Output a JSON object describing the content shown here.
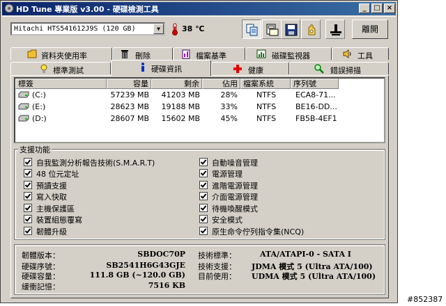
{
  "window": {
    "title": "HD Tune 專業版 v3.00 - 硬碟檢測工具",
    "minimize": "_",
    "maximize": "□",
    "close": "×"
  },
  "toolbar": {
    "drive_value": "Hitachi HTS541612J9S (120 GB)",
    "temperature": "38 ℃",
    "tools": [
      "copy-info-icon",
      "copy-screenshot-icon",
      "save-icon",
      "options-icon",
      "eject-icon"
    ],
    "exit_label": "離開"
  },
  "tabs": {
    "row1": [
      {
        "label": "資料夾使用率",
        "icon": "folder-icon"
      },
      {
        "label": "刪除",
        "icon": "trash-icon"
      },
      {
        "label": "檔案基準",
        "icon": "file-benchmark-icon"
      },
      {
        "label": "磁碟監視器",
        "icon": "monitor-icon"
      },
      {
        "label": "工具",
        "icon": "speaker-icon"
      }
    ],
    "row2": [
      {
        "label": "標準測試",
        "icon": "lightbulb-icon"
      },
      {
        "label": "硬碟資訊",
        "icon": "info-icon",
        "selected": true
      },
      {
        "label": "健康",
        "icon": "health-cross-icon"
      },
      {
        "label": "錯誤掃描",
        "icon": "magnifier-icon"
      }
    ]
  },
  "partitions": {
    "headers": [
      "標簽",
      "容量",
      "剩余",
      "佔用",
      "檔案系統",
      "序列號"
    ],
    "rows": [
      {
        "label": "(C:)",
        "capacity": "57239 MB",
        "free": "41203 MB",
        "used": "28%",
        "fs": "NTFS",
        "serial": "ECA8-71..."
      },
      {
        "label": "(E:)",
        "capacity": "28623 MB",
        "free": "19188 MB",
        "used": "33%",
        "fs": "NTFS",
        "serial": "BE16-DD..."
      },
      {
        "label": "(D:)",
        "capacity": "28607 MB",
        "free": "15602 MB",
        "used": "45%",
        "fs": "NTFS",
        "serial": "FB5B-4EF1"
      }
    ]
  },
  "features": {
    "title": "支援功能",
    "left": [
      "自我監測分析報告技術(S.M.A.R.T)",
      "48 位元定址",
      "預讀支援",
      "寫入快取",
      "主機保護區",
      "裝置組態覆寫",
      "韌體升級"
    ],
    "right": [
      "自動噪音管理",
      "電源管理",
      "進階電源管理",
      "介面電源管理",
      "待機喚醒模式",
      "安全模式",
      "原生命令佇列指令集(NCQ)"
    ]
  },
  "info": {
    "left": [
      {
        "label": "韌體版本：",
        "value": "SBDOC70P"
      },
      {
        "label": "硬碟序號：",
        "value": "SB2541H6G43GJE"
      },
      {
        "label": "硬碟容量：",
        "value": "111.8 GB (~120.0 GB)"
      },
      {
        "label": "緩衝記憶：",
        "value": "7516 KB"
      }
    ],
    "right": [
      {
        "label": "技術標準：",
        "value": "ATA/ATAPI-0 - SATA I"
      },
      {
        "label": "技術支援：",
        "value": "JDMA 模式 5 (Ultra ATA/100)"
      },
      {
        "label": "目前使用：",
        "value": "UDMA 模式 5 (Ultra ATA/100)"
      }
    ]
  },
  "watermark": "#852387"
}
